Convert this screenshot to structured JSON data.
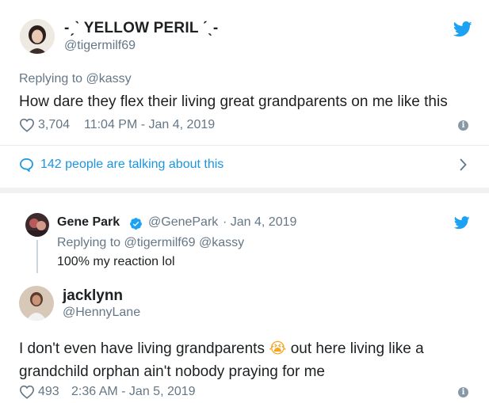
{
  "tweet1": {
    "display_name_prefix": "-ˏˋ",
    "display_name": "YELLOW PERIL",
    "display_name_suffix": "ˊˎ-",
    "handle": "@tigermilf69",
    "replying_to": "Replying to @kassy",
    "text": "How dare they flex their living great grandparents on me like this",
    "likes": "3,704",
    "timestamp": "11:04 PM - Jan 4, 2019"
  },
  "talking": {
    "label": "142 people are talking about this"
  },
  "tweet2": {
    "display_name": "Gene Park",
    "handle": "@GenePark",
    "date": "· Jan 4, 2019",
    "replying_to": "Replying to @tigermilf69 @kassy",
    "text": "100% my reaction lol"
  },
  "tweet3": {
    "display_name": "jacklynn",
    "handle": "@HennyLane",
    "text_line1_a": "I don't even have living grandparents",
    "emoji": "😭",
    "text_line1_b": "out here living like a",
    "text_line2": "grandchild orphan ain't nobody praying for me",
    "likes": "493",
    "timestamp": "2:36 AM - Jan 5, 2019"
  },
  "icons": {
    "twitter": "twitter-bird-icon",
    "heart": "heart-icon",
    "info": "info-icon",
    "speech": "speech-bubble-icon",
    "chevron": "chevron-right-icon",
    "verified": "verified-badge-icon"
  },
  "colors": {
    "accent": "#1da1f2",
    "link": "#1b95e0",
    "meta": "#657786",
    "text": "#1c2022"
  }
}
